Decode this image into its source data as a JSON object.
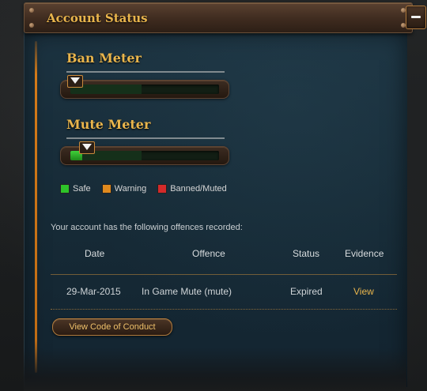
{
  "header": {
    "title": "Account Status"
  },
  "ban_meter": {
    "title": "Ban Meter",
    "level": 0.0
  },
  "mute_meter": {
    "title": "Mute Meter",
    "level": 0.08
  },
  "legend": [
    {
      "label": "Safe",
      "color": "#2ec42a"
    },
    {
      "label": "Warning",
      "color": "#e08a1e"
    },
    {
      "label": "Banned/Muted",
      "color": "#d42a2a"
    }
  ],
  "intro": "Your account has the following offences recorded:",
  "table": {
    "headers": {
      "date": "Date",
      "offence": "Offence",
      "status": "Status",
      "evidence": "Evidence"
    },
    "row": {
      "date": "29-Mar-2015",
      "offence": "In Game Mute (mute)",
      "status": "Expired",
      "evidence": "View"
    }
  },
  "coc_button": "View Code of Conduct",
  "icons": {
    "collapse": "minus-icon",
    "pointer": "triangle-down-icon"
  },
  "colors": {
    "accent": "#e9b54c",
    "panel": "#1c3341"
  }
}
